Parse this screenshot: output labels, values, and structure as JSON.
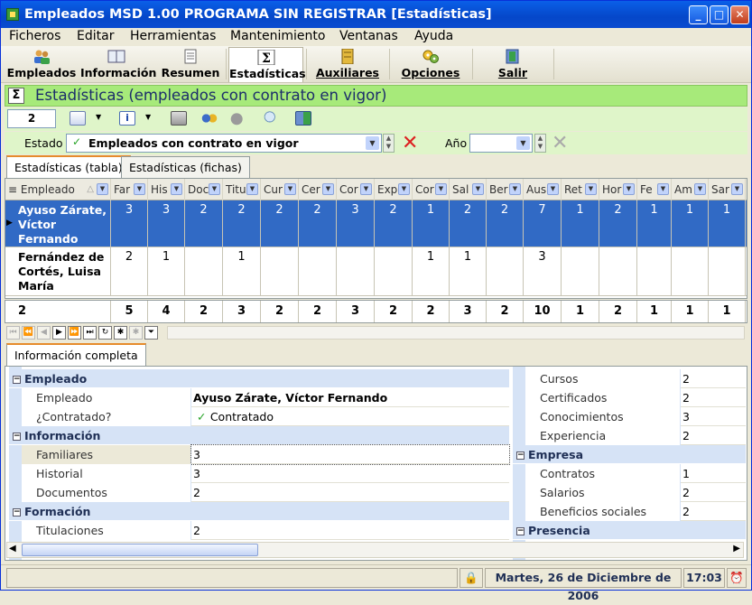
{
  "window": {
    "title": "Empleados MSD 1.00 PROGRAMA SIN REGISTRAR [Estadísticas]"
  },
  "menu": [
    "Ficheros",
    "Editar",
    "Herramientas",
    "Mantenimiento",
    "Ventanas",
    "Ayuda"
  ],
  "toolbar": [
    {
      "label": "Empleados",
      "icon": "people-icon"
    },
    {
      "label": "Información",
      "icon": "book-icon"
    },
    {
      "label": "Resumen",
      "icon": "document-icon"
    },
    {
      "label": "Estadísticas",
      "icon": "sigma-icon",
      "active": true
    },
    {
      "label": "Auxiliares",
      "icon": "binder-icon"
    },
    {
      "label": "Opciones",
      "icon": "gears-icon"
    },
    {
      "label": "Salir",
      "icon": "exit-door-icon"
    }
  ],
  "section": {
    "title": "Estadísticas (empleados con contrato en vigor)"
  },
  "subtoolbar": {
    "counter": "2"
  },
  "filter": {
    "estado_label": "Estado",
    "estado_value": "Empleados con contrato en vigor",
    "anio_label": "Año",
    "anio_value": ""
  },
  "tabs": [
    "Estadísticas (tabla)",
    "Estadísticas (fichas)"
  ],
  "grid": {
    "columns": [
      "Empleado",
      "Far",
      "His",
      "Doc",
      "Titu",
      "Cur",
      "Cer",
      "Cor",
      "Exp",
      "Cor",
      "Sal",
      "Ber",
      "Aus",
      "Ret",
      "Hor",
      "Fe",
      "Am",
      "Sar"
    ],
    "rows": [
      {
        "name": "Ayuso Zárate, Víctor Fernando",
        "values": [
          "3",
          "3",
          "2",
          "2",
          "2",
          "2",
          "3",
          "2",
          "1",
          "2",
          "2",
          "7",
          "1",
          "2",
          "1",
          "1",
          "1"
        ],
        "selected": true
      },
      {
        "name": "Fernández de Cortés, Luisa María",
        "values": [
          "2",
          "1",
          "",
          "1",
          "",
          "",
          "",
          "",
          "1",
          "1",
          "",
          "3",
          "",
          "",
          "",
          "",
          ""
        ],
        "selected": false
      }
    ],
    "footer": {
      "count": "2",
      "totals": [
        "5",
        "4",
        "2",
        "3",
        "2",
        "2",
        "3",
        "2",
        "2",
        "3",
        "2",
        "10",
        "1",
        "2",
        "1",
        "1",
        "1"
      ]
    }
  },
  "detail_tab": "Información completa",
  "detail": {
    "left": [
      {
        "category": "Empleado"
      },
      {
        "name": "Empleado",
        "value": "Ayuso Zárate, Víctor Fernando",
        "bold": true
      },
      {
        "name": "¿Contratado?",
        "value": "Contratado",
        "check": true
      },
      {
        "category": "Información"
      },
      {
        "name": "Familiares",
        "value": "3",
        "focused": true
      },
      {
        "name": "Historial",
        "value": "3"
      },
      {
        "name": "Documentos",
        "value": "2"
      },
      {
        "category": "Formación"
      },
      {
        "name": "Titulaciones",
        "value": "2"
      }
    ],
    "right": [
      {
        "name": "Cursos",
        "value": "2"
      },
      {
        "name": "Certificados",
        "value": "2"
      },
      {
        "name": "Conocimientos",
        "value": "3"
      },
      {
        "name": "Experiencia",
        "value": "2"
      },
      {
        "category": "Empresa"
      },
      {
        "name": "Contratos",
        "value": "1"
      },
      {
        "name": "Salarios",
        "value": "2"
      },
      {
        "name": "Beneficios sociales",
        "value": "2"
      },
      {
        "category": "Presencia"
      }
    ]
  },
  "status": {
    "date": "Martes, 26 de Diciembre de 2006",
    "time": "17:03"
  }
}
